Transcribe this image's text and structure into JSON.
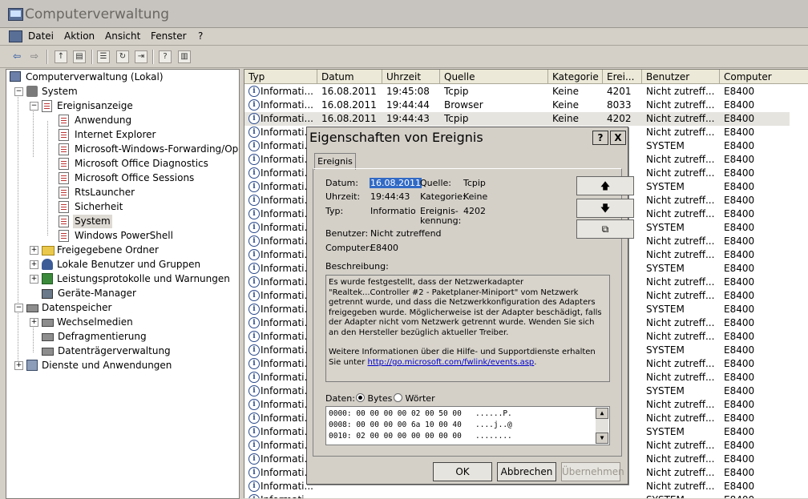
{
  "window": {
    "title": "Computerverwaltung"
  },
  "menu": [
    "Datei",
    "Aktion",
    "Ansicht",
    "Fenster",
    "?"
  ],
  "tree": {
    "root": "Computerverwaltung (Lokal)",
    "system": "System",
    "event_viewer": "Ereignisanzeige",
    "logs": [
      "Anwendung",
      "Internet Explorer",
      "Microsoft-Windows-Forwarding/Ope",
      "Microsoft Office Diagnostics",
      "Microsoft Office Sessions",
      "RtsLauncher",
      "Sicherheit",
      "System",
      "Windows PowerShell"
    ],
    "shared_folders": "Freigegebene Ordner",
    "local_users": "Lokale Benutzer und Gruppen",
    "perf_logs": "Leistungsprotokolle und Warnungen",
    "device_manager": "Geräte-Manager",
    "storage": "Datenspeicher",
    "removable": "Wechselmedien",
    "defrag": "Defragmentierung",
    "disk_mgmt": "Datenträgerverwaltung",
    "services": "Dienste und Anwendungen"
  },
  "list": {
    "columns": [
      "Typ",
      "Datum",
      "Uhrzeit",
      "Quelle",
      "Kategorie",
      "Erei...",
      "Benutzer",
      "Computer"
    ],
    "rows": [
      [
        "Informati...",
        "16.08.2011",
        "19:45:08",
        "Tcpip",
        "Keine",
        "4201",
        "Nicht zutreff...",
        "E8400"
      ],
      [
        "Informati...",
        "16.08.2011",
        "19:44:44",
        "Browser",
        "Keine",
        "8033",
        "Nicht zutreff...",
        "E8400"
      ],
      [
        "Informati...",
        "16.08.2011",
        "19:44:43",
        "Tcpip",
        "Keine",
        "4202",
        "Nicht zutreff...",
        "E8400"
      ],
      [
        "Informati...",
        "",
        "",
        "",
        "",
        "",
        "Nicht zutreff...",
        "E8400"
      ],
      [
        "Informati...",
        "",
        "",
        "",
        "",
        "",
        "SYSTEM",
        "E8400"
      ],
      [
        "Informati...",
        "",
        "",
        "",
        "",
        "",
        "Nicht zutreff...",
        "E8400"
      ],
      [
        "Informati...",
        "",
        "",
        "",
        "",
        "",
        "Nicht zutreff...",
        "E8400"
      ],
      [
        "Informati...",
        "",
        "",
        "",
        "",
        "",
        "SYSTEM",
        "E8400"
      ],
      [
        "Informati...",
        "",
        "",
        "",
        "",
        "",
        "Nicht zutreff...",
        "E8400"
      ],
      [
        "Informati...",
        "",
        "",
        "",
        "",
        "",
        "Nicht zutreff...",
        "E8400"
      ],
      [
        "Informati...",
        "",
        "",
        "",
        "",
        "",
        "SYSTEM",
        "E8400"
      ],
      [
        "Informati...",
        "",
        "",
        "",
        "",
        "",
        "Nicht zutreff...",
        "E8400"
      ],
      [
        "Informati...",
        "",
        "",
        "",
        "",
        "",
        "Nicht zutreff...",
        "E8400"
      ],
      [
        "Informati...",
        "",
        "",
        "",
        "",
        "",
        "SYSTEM",
        "E8400"
      ],
      [
        "Informati...",
        "",
        "",
        "",
        "",
        "",
        "Nicht zutreff...",
        "E8400"
      ],
      [
        "Informati...",
        "",
        "",
        "",
        "",
        "",
        "Nicht zutreff...",
        "E8400"
      ],
      [
        "Informati...",
        "",
        "",
        "",
        "",
        "",
        "SYSTEM",
        "E8400"
      ],
      [
        "Informati...",
        "",
        "",
        "",
        "",
        "",
        "Nicht zutreff...",
        "E8400"
      ],
      [
        "Informati...",
        "",
        "",
        "",
        "",
        "",
        "Nicht zutreff...",
        "E8400"
      ],
      [
        "Informati...",
        "",
        "",
        "",
        "",
        "",
        "SYSTEM",
        "E8400"
      ],
      [
        "Informati...",
        "",
        "",
        "",
        "",
        "",
        "Nicht zutreff...",
        "E8400"
      ],
      [
        "Informati...",
        "",
        "",
        "",
        "",
        "",
        "Nicht zutreff...",
        "E8400"
      ],
      [
        "Informati...",
        "",
        "",
        "",
        "",
        "",
        "SYSTEM",
        "E8400"
      ],
      [
        "Informati...",
        "",
        "",
        "",
        "",
        "",
        "Nicht zutreff...",
        "E8400"
      ],
      [
        "Informati...",
        "",
        "",
        "",
        "",
        "",
        "Nicht zutreff...",
        "E8400"
      ],
      [
        "Informati...",
        "",
        "",
        "",
        "",
        "",
        "SYSTEM",
        "E8400"
      ],
      [
        "Informati...",
        "",
        "",
        "",
        "",
        "",
        "Nicht zutreff...",
        "E8400"
      ],
      [
        "Informati...",
        "",
        "",
        "",
        "",
        "",
        "Nicht zutreff...",
        "E8400"
      ],
      [
        "Informati...",
        "",
        "",
        "",
        "",
        "",
        "Nicht zutreff...",
        "E8400"
      ],
      [
        "Informati...",
        "",
        "",
        "",
        "",
        "",
        "Nicht zutreff...",
        "E8400"
      ],
      [
        "Informati...",
        "",
        "",
        "",
        "",
        "",
        "SYSTEM",
        "E8400"
      ]
    ]
  },
  "dialog": {
    "title": "Eigenschaften von Ereignis",
    "help": "?",
    "close": "X",
    "tab": "Ereignis",
    "date_label": "Datum:",
    "date_value": "16.08.2011",
    "source_label": "Quelle:",
    "source_value": "Tcpip",
    "time_label": "Uhrzeit:",
    "time_value": "19:44:43",
    "category_label": "Kategorie:",
    "category_value": "Keine",
    "type_label": "Typ:",
    "type_value": "Information",
    "eventid_label_1": "Ereignis-",
    "eventid_label_2": "kennung:",
    "eventid_value": "4202",
    "user_label": "Benutzer:",
    "user_value": "Nicht zutreffend",
    "computer_label": "Computer:",
    "computer_value": "E8400",
    "desc_label": "Beschreibung:",
    "desc_text": "Es wurde festgestellt, dass der Netzwerkadapter \"Realtek...Controller #2 - Paketplaner-Miniport\" vom Netzwerk getrennt wurde, und dass die Netzwerkkonfiguration des Adapters freigegeben wurde. Möglicherweise ist der Adapter beschädigt, falls der Adapter nicht vom Netzwerk getrennt wurde. Wenden Sie sich an den Hersteller bezüglich aktueller Treiber.",
    "desc_more": "Weitere Informationen über die Hilfe- und Supportdienste erhalten Sie unter ",
    "desc_link": "http://go.microsoft.com/fwlink/events.asp",
    "desc_end": ".",
    "data_label": "Daten:",
    "bytes": "Bytes",
    "words": "Wörter",
    "hex": [
      "0000: 00 00 00 00 02 00 50 00   ......P.",
      "0008: 00 00 00 00 6a 10 00 40   ....j..@",
      "0010: 02 00 00 00 00 00 00 00   ........"
    ],
    "ok": "OK",
    "cancel": "Abbrechen",
    "apply": "Übernehmen"
  }
}
